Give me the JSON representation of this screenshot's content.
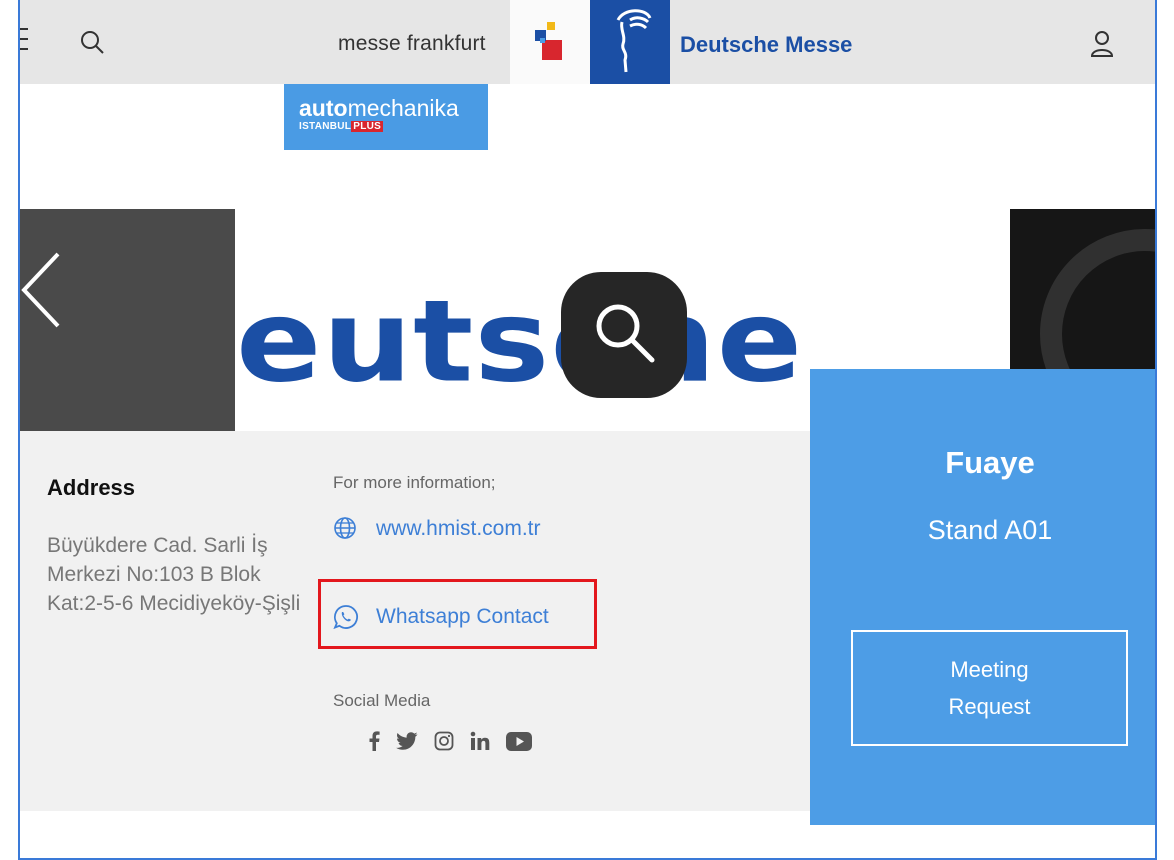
{
  "header": {
    "menu_icon": "hamburger-icon",
    "search_icon": "search-icon",
    "messe_frankfurt_label": "messe frankfurt",
    "deutsche_messe_label": "Deutsche Messe",
    "user_icon": "user-icon"
  },
  "event_logo": {
    "bold": "auto",
    "regular": "mechanika",
    "sub": "ISTANBUL",
    "plus": "PLUS"
  },
  "carousel": {
    "slide_text": "eutsche",
    "prev_icon": "chevron-left-icon",
    "zoom_icon": "zoom-icon"
  },
  "address": {
    "title": "Address",
    "text": "Büyükdere Cad. Sarli İş Merkezi No:103 B Blok Kat:2-5-6 Mecidiyeköy-Şişli"
  },
  "contact": {
    "more_info": "For more information;",
    "website": "www.hmist.com.tr",
    "whatsapp": "Whatsapp Contact"
  },
  "social": {
    "title": "Social Media",
    "icons": [
      "facebook-icon",
      "twitter-icon",
      "instagram-icon",
      "linkedin-icon",
      "youtube-icon"
    ]
  },
  "stand": {
    "hall": "Fuaye",
    "number": "Stand A01",
    "meeting_label": "Meeting Request"
  },
  "colors": {
    "brand_blue": "#1b4fa5",
    "panel_blue": "#4d9de6",
    "link_blue": "#3d7fd6",
    "highlight_red": "#e3171d"
  }
}
